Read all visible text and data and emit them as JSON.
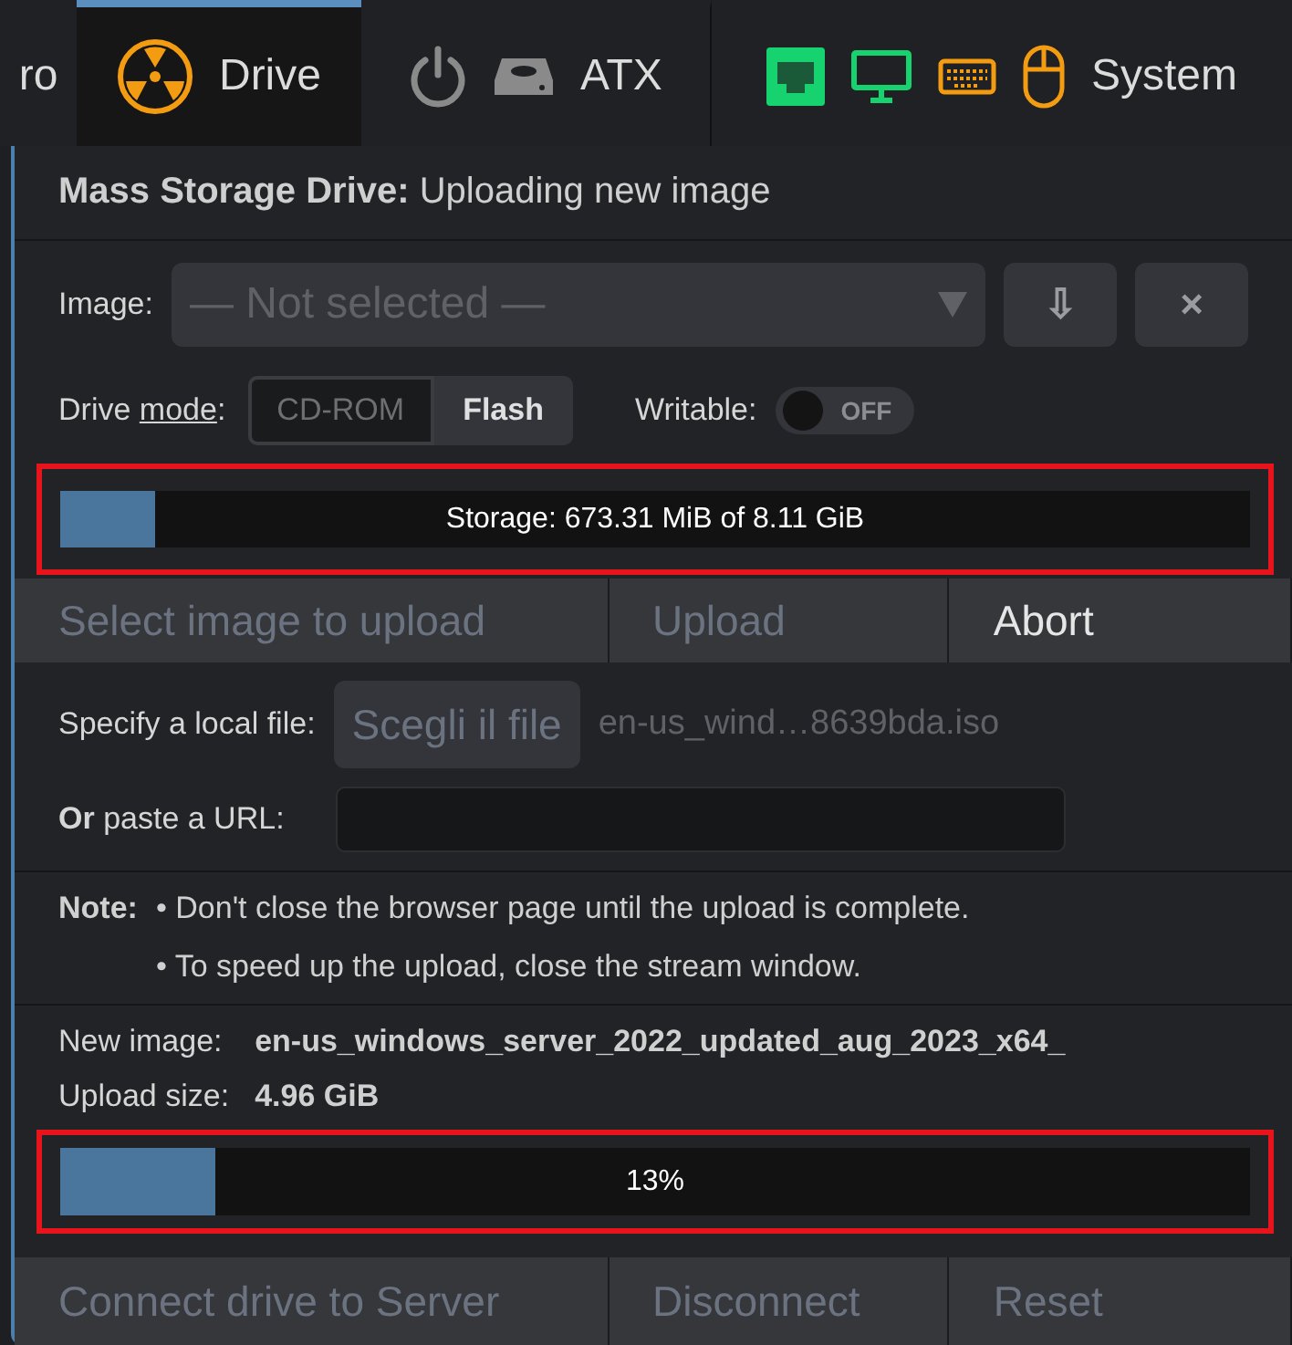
{
  "nav": {
    "tabs": [
      {
        "label": "ro",
        "selected": false
      },
      {
        "label": "Drive",
        "selected": true,
        "icons": [
          {
            "kind": "drive",
            "color": "#f39c12"
          }
        ]
      },
      {
        "label": "ATX",
        "selected": false,
        "icons": [
          {
            "kind": "power",
            "color": "#8a8a8a"
          },
          {
            "kind": "hdd",
            "color": "#8a8a8a"
          }
        ]
      },
      {
        "label": "System",
        "selected": false,
        "icons": [
          {
            "kind": "ethernet",
            "color": "#17d36f"
          },
          {
            "kind": "monitor",
            "color": "#17d36f"
          },
          {
            "kind": "keyboard",
            "color": "#f39c12"
          },
          {
            "kind": "mouse",
            "color": "#f39c12"
          }
        ]
      }
    ]
  },
  "title": "**Mass Storage Drive:** Uploading new image",
  "image": {
    "label": "Image:",
    "placeholder": "— Not selected —",
    "buttons": [
      "⇩",
      "×"
    ]
  },
  "drive_mode": {
    "prefix": "Drive ",
    "underlined": "mode",
    "suffix": ":",
    "options": [
      {
        "label": "CD-ROM",
        "selected": false
      },
      {
        "label": "Flash",
        "selected": true
      }
    ]
  },
  "writable": {
    "label": "Writable:",
    "on": false,
    "state_text": "OFF"
  },
  "storage": {
    "text": "Storage: 673.31 MiB of 8.11 GiB",
    "level": 0.08,
    "highlighted": true
  },
  "upload_tabs": [
    {
      "label": "Select image to upload",
      "disabled": true
    },
    {
      "label": "Upload",
      "disabled": true
    },
    {
      "label": "Abort",
      "disabled": false
    }
  ],
  "local_file": {
    "label": "Specify a local file:",
    "button": "Scegli il file",
    "disabled": true,
    "filename": "en-us_wind…8639bda.iso"
  },
  "url": {
    "label": "**Or** paste a URL:"
  },
  "note": {
    "label": "Note:",
    "items": [
      "• Don't close the browser page until the upload is complete.",
      "• To speed up the upload, close the stream window."
    ]
  },
  "info": [
    {
      "label": "New image:",
      "value": "en-us_windows_server_2022_updated_aug_2023_x64_"
    },
    {
      "label": "Upload size:",
      "value": "4.96 GiB"
    }
  ],
  "progress": {
    "text": "13%",
    "level": 0.13,
    "highlighted": true
  },
  "actions": [
    {
      "label": "Connect drive to Server",
      "disabled": true
    },
    {
      "label": "Disconnect",
      "disabled": true
    },
    {
      "label": "Reset",
      "disabled": true
    }
  ]
}
